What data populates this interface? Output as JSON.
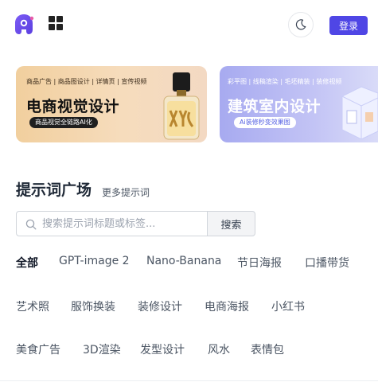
{
  "header": {
    "logo_icon": "brand-logo-icon",
    "apps_icon": "grid-icon",
    "theme_icon": "moon-icon",
    "login_label": "登录"
  },
  "banners": [
    {
      "subtitle": "商品广告 | 商品图设计 | 详情页 | 宣传视频",
      "title": "电商视觉设计",
      "pill": "商品视觉全链路AI化"
    },
    {
      "subtitle": "彩平图 | 线稿渲染 | 毛坯精装 | 装修视频",
      "title": "建筑室内设计",
      "pill": "Ai装修秒变效果图"
    }
  ],
  "section": {
    "title": "提示词广场",
    "more": "更多提示词"
  },
  "search": {
    "placeholder": "搜索提示词标题或标签...",
    "button": "搜索"
  },
  "tags": [
    "全部",
    "GPT-image 2",
    "Nano-Banana",
    "节日海报",
    "口播带货",
    "艺术照",
    "服饰换装",
    "装修设计",
    "电商海报",
    "小红书",
    "美食广告",
    "3D渲染",
    "发型设计",
    "风水",
    "表情包"
  ],
  "active_tag": "全部",
  "colors": {
    "accent": "#4f46e5",
    "banner1": "#f1cf9e",
    "banner2": "#a7aaf0"
  }
}
